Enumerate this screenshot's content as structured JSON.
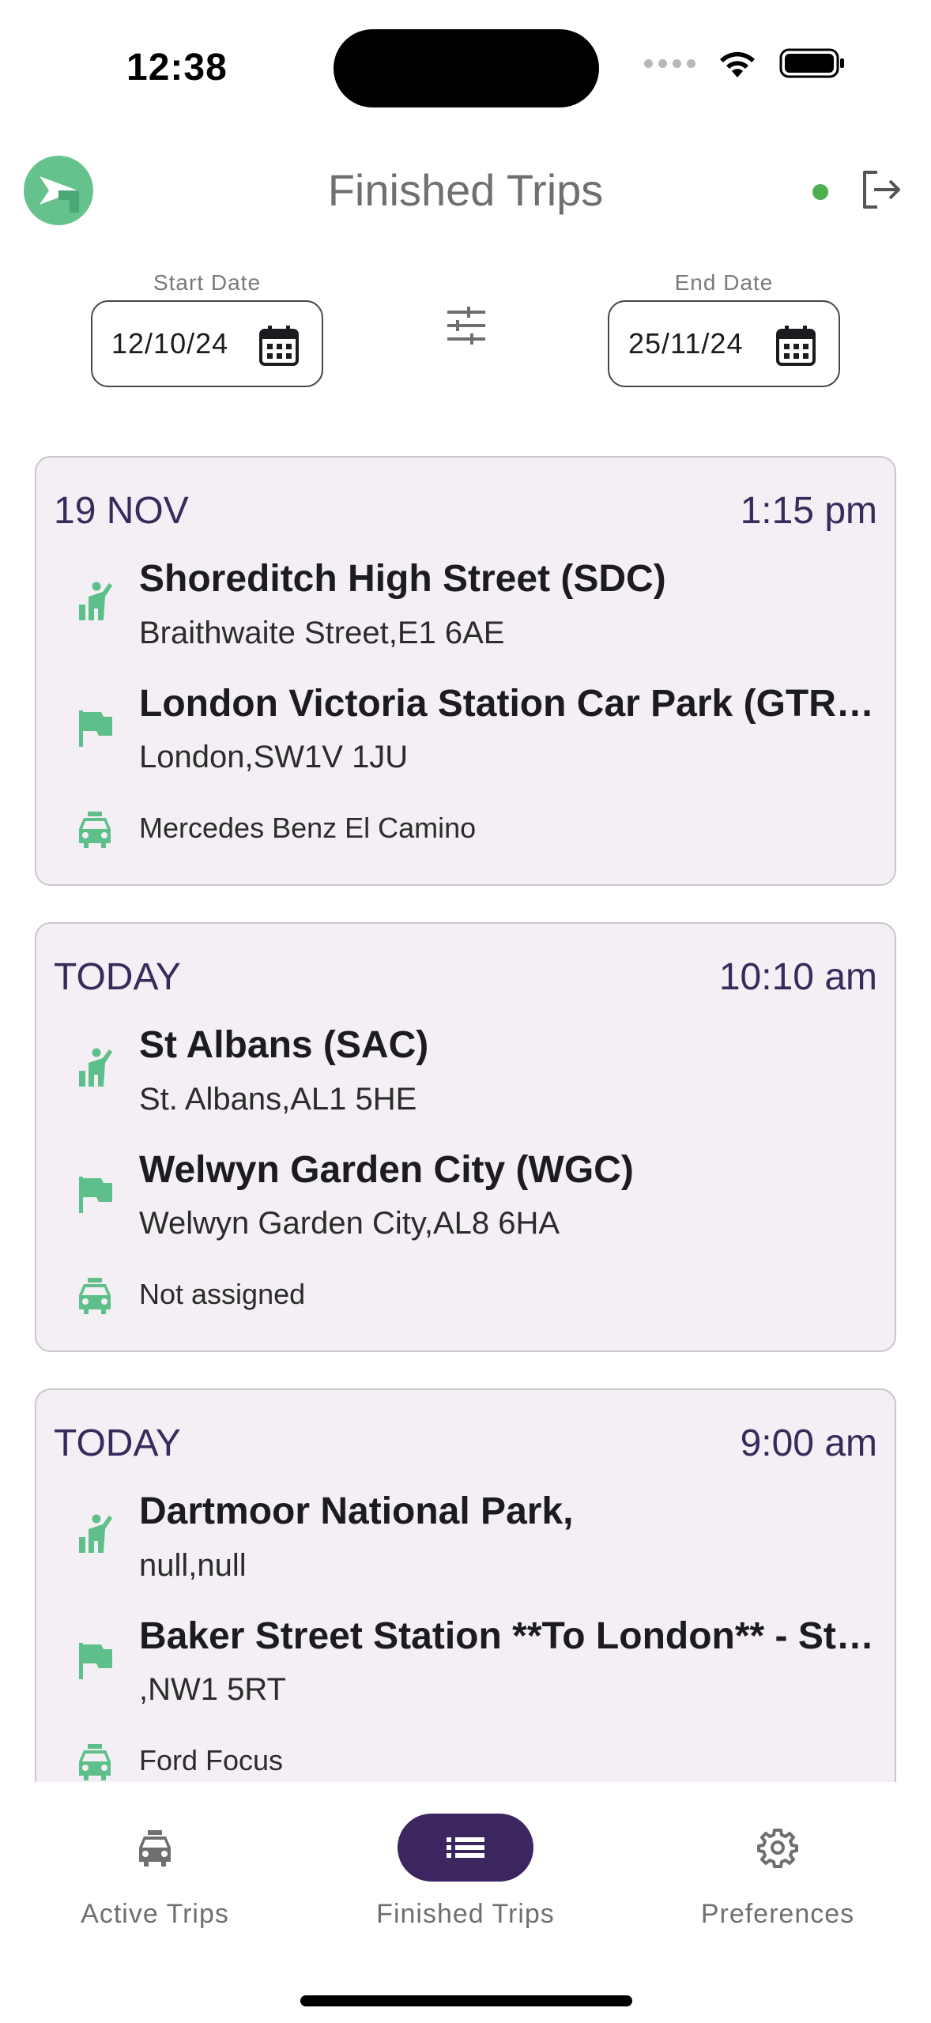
{
  "status_bar": {
    "time": "12:38"
  },
  "header": {
    "title": "Finished Trips"
  },
  "filters": {
    "start_label": "Start Date",
    "start_value": "12/10/24",
    "end_label": "End Date",
    "end_value": "25/11/24"
  },
  "colors": {
    "accent": "#3b2660",
    "icon_green": "#5fbf8a",
    "online": "#4caf50",
    "card_bg": "#f3eff4"
  },
  "trips": [
    {
      "date": "19 NOV",
      "time": "1:15 pm",
      "pickup_name": "Shoreditch High Street (SDC)",
      "pickup_address": "Braithwaite Street,E1 6AE",
      "dropoff_name": "London Victoria Station Car Park (GTR) - London",
      "dropoff_address": "London,SW1V 1JU",
      "vehicle": "Mercedes Benz El Camino"
    },
    {
      "date": "TODAY",
      "time": "10:10 am",
      "pickup_name": "St Albans (SAC)",
      "pickup_address": "St. Albans,AL1 5HE",
      "dropoff_name": "Welwyn Garden City (WGC)",
      "dropoff_address": "Welwyn Garden City,AL8 6HA",
      "vehicle": "Not assigned"
    },
    {
      "date": "TODAY",
      "time": "9:00 am",
      "pickup_name": "Dartmoor National Park,",
      "pickup_address": "null,null",
      "dropoff_name": "Baker Street Station **To London** - Station",
      "dropoff_address": ",NW1 5RT",
      "vehicle": "Ford Focus"
    }
  ],
  "nav": [
    {
      "label": "Active Trips",
      "icon": "car-icon",
      "active": false
    },
    {
      "label": "Finished Trips",
      "icon": "list-icon",
      "active": true
    },
    {
      "label": "Preferences",
      "icon": "gear-icon",
      "active": false
    }
  ]
}
